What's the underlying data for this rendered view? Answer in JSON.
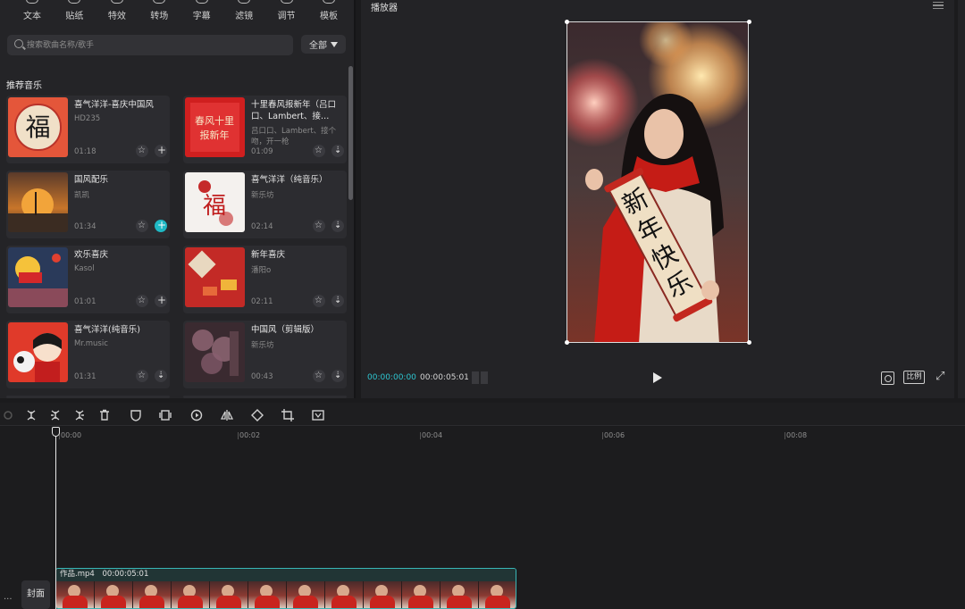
{
  "top_tabs": [
    {
      "label": "文本",
      "icon": "text-icon"
    },
    {
      "label": "贴纸",
      "icon": "sticker-icon"
    },
    {
      "label": "特效",
      "icon": "effects-icon"
    },
    {
      "label": "转场",
      "icon": "transition-icon"
    },
    {
      "label": "字幕",
      "icon": "subtitle-icon"
    },
    {
      "label": "滤镜",
      "icon": "filter-icon"
    },
    {
      "label": "调节",
      "icon": "adjust-icon"
    },
    {
      "label": "模板",
      "icon": "template-icon"
    }
  ],
  "search": {
    "placeholder": "搜索歌曲名称/歌手"
  },
  "filter": {
    "label": "全部"
  },
  "section_title": "推荐音乐",
  "music": [
    {
      "title": "喜气洋洋-喜庆中国风",
      "artist": "HD235",
      "duration": "01:18",
      "action": "plus",
      "active": false,
      "thumb": "fu-red"
    },
    {
      "title": "十里春风报新年（吕口口、Lambert、接…",
      "artist": "吕口口、Lambert、接个吻，开一枪",
      "duration": "01:09",
      "action": "download",
      "active": false,
      "thumb": "red-calligraphy"
    },
    {
      "title": "国风配乐",
      "artist": "凯凯",
      "duration": "01:34",
      "action": "plus",
      "active": true,
      "thumb": "sunset"
    },
    {
      "title": "喜气洋洋（纯音乐）",
      "artist": "新乐坊",
      "duration": "02:14",
      "action": "download",
      "active": false,
      "thumb": "fu-white"
    },
    {
      "title": "欢乐喜庆",
      "artist": "Kasol",
      "duration": "01:01",
      "action": "plus",
      "active": false,
      "thumb": "festival"
    },
    {
      "title": "新年喜庆",
      "artist": "潘阳o",
      "duration": "02:11",
      "action": "download",
      "active": false,
      "thumb": "red-gifts"
    },
    {
      "title": "喜气洋洋(纯音乐)",
      "artist": "Mr.music",
      "duration": "01:31",
      "action": "download",
      "active": false,
      "thumb": "cartoon"
    },
    {
      "title": "中国风（剪辑版）",
      "artist": "新乐坊",
      "duration": "00:43",
      "action": "download",
      "active": false,
      "thumb": "blossom"
    }
  ],
  "player": {
    "title": "播放器",
    "current_time": "00:00:00:00",
    "total_time": "00:00:05:01",
    "ratio_label": "比例",
    "scroll_text": [
      "新",
      "年",
      "快",
      "乐"
    ]
  },
  "timeline": {
    "ticks": [
      "00:00",
      "00:02",
      "00:04",
      "00:06",
      "00:08"
    ],
    "cover_label": "封面",
    "more_label": "···",
    "clip_name": "作品.mp4",
    "clip_duration": "00:00:05:01",
    "frame_count": 12
  },
  "toolbar_icons": [
    "undo-icon",
    "split-icon",
    "split-left-icon",
    "split-right-icon",
    "delete-icon",
    "mask-icon",
    "freeze-icon",
    "play-circle-icon",
    "mirror-icon",
    "rotate-icon",
    "crop-icon",
    "smart-crop-icon"
  ],
  "colors": {
    "accent": "#2ec7d2",
    "clip_border": "#38b6b6",
    "panel": "#242427",
    "background": "#1b1b1d"
  }
}
